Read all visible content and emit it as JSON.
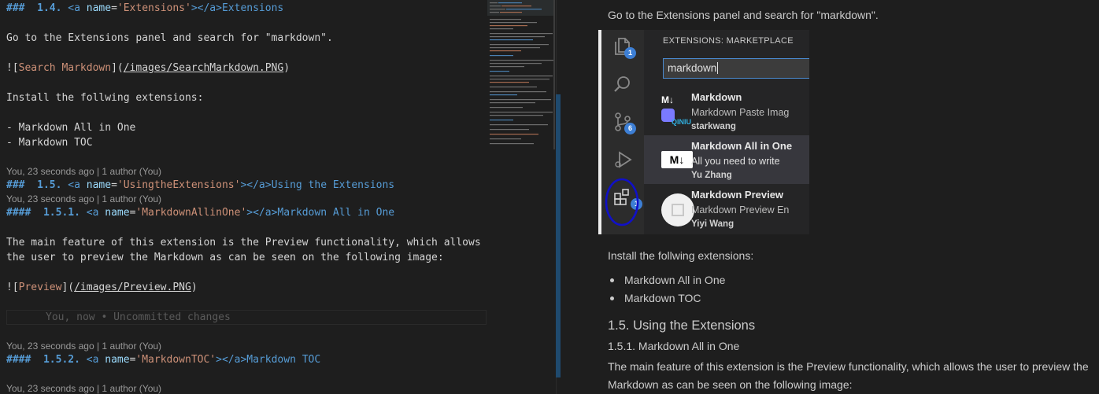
{
  "editor": {
    "h14": {
      "hashes": "###",
      "num": "1.4.",
      "a_open": "<a",
      "name_attr": "name",
      "eq": "=",
      "name_val": "'Extensions'",
      "a_close": "></a>",
      "text": "Extensions"
    },
    "intro": "Go to the Extensions panel and search for \"markdown\".",
    "search_img": {
      "bang": "![",
      "alt": "Search Markdown",
      "mid": "](",
      "url": "/images/SearchMarkdown.PNG",
      "end": ")"
    },
    "install": "Install the follwing extensions:",
    "list": [
      "- Markdown All in One",
      "- Markdown TOC"
    ],
    "lens1": "You, 23 seconds ago | 1 author (You)",
    "h15": {
      "hashes": "###",
      "num": "1.5.",
      "a_open": "<a",
      "name_attr": "name",
      "eq": "=",
      "name_val": "'UsingtheExtensions'",
      "a_close": "></a>",
      "text": "Using the Extensions"
    },
    "lens2": "You, 23 seconds ago | 1 author (You)",
    "h151": {
      "hashes": "####",
      "num": "1.5.1.",
      "a_open": "<a",
      "name_attr": "name",
      "eq": "=",
      "name_val": "'MarkdownAllinOne'",
      "a_close": "></a>",
      "text": "Markdown All in One"
    },
    "para1": "The main feature of this extension is the Preview functionality, which allows",
    "para2": "the user to preview the Markdown as can be seen on the following image:",
    "preview_img": {
      "bang": "![",
      "alt": "Preview",
      "mid": "](",
      "url": "/images/Preview.PNG",
      "end": ")"
    },
    "ghost": "You, now • Uncommitted changes",
    "lens3": "You, 23 seconds ago | 1 author (You)",
    "h152": {
      "hashes": "####",
      "num": "1.5.2.",
      "a_open": "<a",
      "name_attr": "name",
      "eq": "=",
      "name_val": "'MarkdownTOC'",
      "a_close": "></a>",
      "text": "Markdown TOC"
    },
    "lens4": "You, 23 seconds ago | 1 author (You)"
  },
  "preview": {
    "intro": "Go to the Extensions panel and search for \"markdown\".",
    "image": {
      "panel_title": "EXTENSIONS: MARKETPLACE",
      "search_value": "markdown",
      "badges": {
        "explorer": "1",
        "scm": "6",
        "extensions": "1"
      },
      "extensions": [
        {
          "name": "Markdown",
          "desc": "Markdown Paste Imag",
          "author": "starkwang",
          "logo": "M↓",
          "logo_sub": "QINIU"
        },
        {
          "name": "Markdown All in One",
          "desc": "All you need to write",
          "author": "Yu Zhang",
          "logo": "M↓"
        },
        {
          "name": "Markdown Preview",
          "desc": "Markdown Preview En",
          "author": "Yiyi Wang"
        }
      ]
    },
    "install": "Install the follwing extensions:",
    "list": [
      "Markdown All in One",
      "Markdown TOC"
    ],
    "h15": "1.5. Using the Extensions",
    "h151": "1.5.1. Markdown All in One",
    "para": [
      "The main feature of this extension is the Preview functionality, which allows the user to preview the",
      "Markdown as can be seen on the following image:"
    ]
  },
  "colors": {
    "accent": "#569cd6",
    "string": "#ce9178",
    "attr": "#9cdcfe",
    "circle": "#1010c8",
    "badge": "#3d7fd5"
  }
}
